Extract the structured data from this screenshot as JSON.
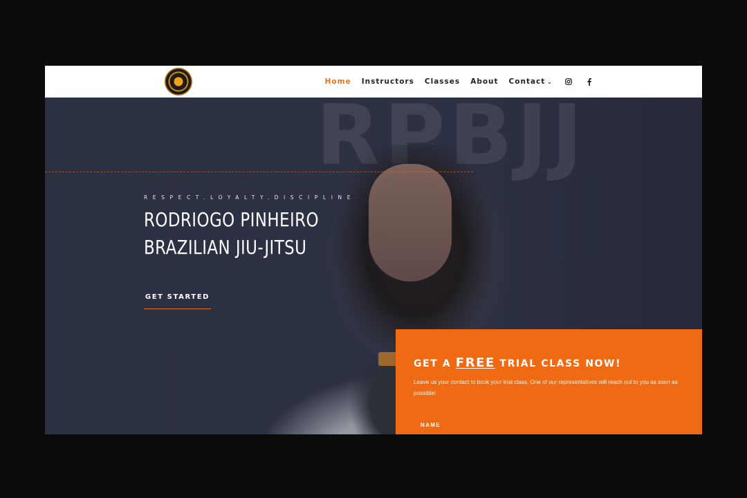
{
  "nav": {
    "items": [
      {
        "label": "Home",
        "active": true
      },
      {
        "label": "Instructors"
      },
      {
        "label": "Classes"
      },
      {
        "label": "About"
      },
      {
        "label": "Contact"
      }
    ],
    "icons": [
      "instagram-icon",
      "facebook-icon"
    ]
  },
  "hero": {
    "background_text": "RPBJJ",
    "tagline": "RESPECT.LOYALTY.DISCIPLINE",
    "title_line1": "RODRIOGO PINHEIRO",
    "title_line2": "BRAZILIAN JIU-JITSU",
    "cta_label": "GET STARTED"
  },
  "trial": {
    "heading_pre": "GET A ",
    "heading_free": "FREE",
    "heading_post": " TRIAL CLASS NOW!",
    "description": "Leave us your contact to book your trial class. One of our representatives will reach out to you as soon as possible!",
    "name_label": "NAME"
  },
  "colors": {
    "accent": "#e8741a",
    "trial_bg": "#ef6a12",
    "hero_bg": "#2c3144"
  }
}
